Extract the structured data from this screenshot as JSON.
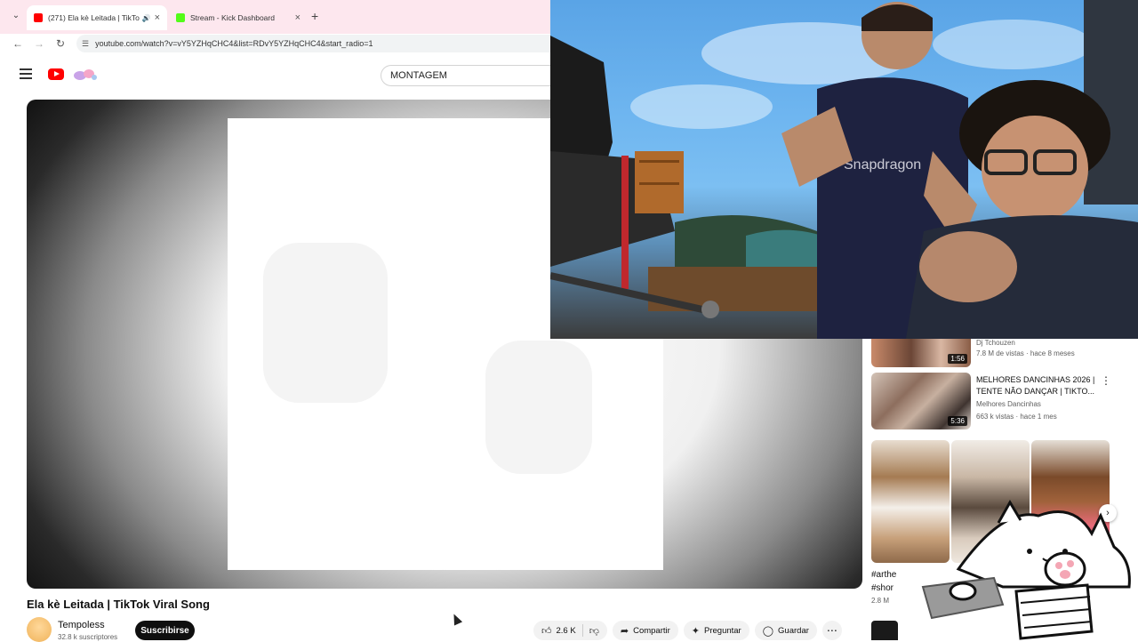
{
  "browser": {
    "tabs": [
      {
        "title": "(271) Ela kè Leitada | TikTok",
        "active": true
      },
      {
        "title": "Stream - Kick Dashboard",
        "active": false
      }
    ],
    "url": "youtube.com/watch?v=vY5YZHqCHC4&list=RDvY5YZHqCHC4&start_radio=1"
  },
  "youtube": {
    "search_value": "MONTAGEM",
    "video": {
      "title": "Ela kè Leitada | TikTok Viral Song",
      "channel": "Tempoless",
      "subscribers": "32.8 k suscriptores",
      "subscribe_label": "Suscribirse",
      "likes": "2.6 K",
      "share_label": "Compartir",
      "ask_label": "Preguntar",
      "save_label": "Guardar"
    },
    "sidebar": [
      {
        "title": "",
        "channel": "Dj Tchouzen",
        "meta": "7.8 M de vistas · hace 8 meses",
        "duration": "1:56"
      },
      {
        "title": "MELHORES DANCINHAS 2026 | TENTE NÃO DANÇAR | TIKTO...",
        "channel": "Melhores Dancinhas",
        "meta": "663 k vistas · hace 1 mes",
        "duration": "5:36"
      }
    ],
    "shorts": {
      "title_line1": "#arthe",
      "title_line2": "#shor",
      "meta": "2.8 M"
    }
  },
  "colors": {
    "youtube_red": "#ff0000",
    "kick_green": "#53fc18",
    "tab_bar": "#fde7ee"
  }
}
